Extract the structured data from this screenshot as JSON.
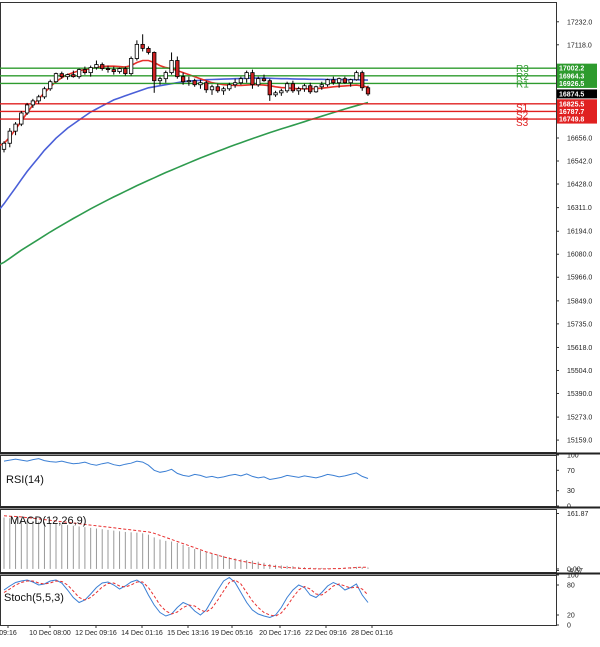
{
  "chart_data": {
    "type": "line",
    "instrument": "candlestick",
    "main": {
      "ylim": [
        15100,
        17330
      ],
      "yticks": [
        17232.0,
        17118.0,
        17002.2,
        16964.3,
        16926.5,
        16874.5,
        16825.5,
        16787.7,
        16749.8,
        16656.0,
        16542.0,
        16428.0,
        16311.0,
        16194.0,
        16080.0,
        15966.0,
        15849.0,
        15735.0,
        15618.0,
        15504.0,
        15390.0,
        15273.0,
        15159.0
      ],
      "tick_labels": [
        "17232.0",
        "17118.0",
        "17002.2",
        "16964.3",
        "16926.5",
        "16874.5",
        "16825.5",
        "16787.7",
        "16749.8",
        "16656.0",
        "16542.0",
        "16428.0",
        "16311.0",
        "16194.0",
        "16080.0",
        "15966.0",
        "15849.0",
        "15735.0",
        "15618.0",
        "15504.0",
        "15390.0",
        "15273.0",
        "15159.0"
      ],
      "current_price": {
        "value": 16874.5,
        "label": "16874.5",
        "color": "#000000"
      },
      "levels": [
        {
          "name": "R3",
          "value": 17002.2,
          "label": "17002.2",
          "color": "#2e9b2e"
        },
        {
          "name": "R2",
          "value": 16964.3,
          "label": "16964.3",
          "color": "#2e9b2e"
        },
        {
          "name": "R1",
          "value": 16926.5,
          "label": "16926.5",
          "color": "#2e9b2e"
        },
        {
          "name": "S1",
          "value": 16825.5,
          "label": "16825.5",
          "color": "#e02020"
        },
        {
          "name": "S2",
          "value": 16787.7,
          "label": "16787.7",
          "color": "#e02020"
        },
        {
          "name": "S3",
          "value": 16749.8,
          "label": "16749.8",
          "color": "#e02020"
        }
      ],
      "candles": [
        [
          16600,
          16640,
          16585,
          16630
        ],
        [
          16630,
          16705,
          16610,
          16690
        ],
        [
          16690,
          16735,
          16670,
          16725
        ],
        [
          16725,
          16790,
          16715,
          16780
        ],
        [
          16780,
          16830,
          16770,
          16820
        ],
        [
          16820,
          16850,
          16805,
          16840
        ],
        [
          16840,
          16870,
          16825,
          16860
        ],
        [
          16860,
          16910,
          16850,
          16900
        ],
        [
          16900,
          16945,
          16890,
          16935
        ],
        [
          16935,
          16980,
          16930,
          16975
        ],
        [
          16975,
          16985,
          16950,
          16960
        ],
        [
          16960,
          16975,
          16945,
          16970
        ],
        [
          16970,
          16990,
          16955,
          16960
        ],
        [
          16960,
          17000,
          16950,
          16995
        ],
        [
          16995,
          17010,
          16970,
          16980
        ],
        [
          16980,
          17015,
          16960,
          17005
        ],
        [
          17005,
          17040,
          16995,
          17020
        ],
        [
          17020,
          17030,
          16990,
          17000
        ],
        [
          17000,
          17015,
          16980,
          16995
        ],
        [
          16995,
          17010,
          16970,
          16985
        ],
        [
          16985,
          17005,
          16975,
          17000
        ],
        [
          17000,
          17010,
          16965,
          16975
        ],
        [
          16975,
          17060,
          16965,
          17050
        ],
        [
          17050,
          17140,
          17040,
          17120
        ],
        [
          17120,
          17170,
          17085,
          17100
        ],
        [
          17100,
          17110,
          17070,
          17080
        ],
        [
          17080,
          17085,
          16880,
          16940
        ],
        [
          16940,
          16960,
          16920,
          16950
        ],
        [
          16950,
          16990,
          16930,
          16980
        ],
        [
          16980,
          17080,
          16970,
          17040
        ],
        [
          17040,
          17060,
          16950,
          16960
        ],
        [
          16960,
          16980,
          16920,
          16935
        ],
        [
          16935,
          16960,
          16915,
          16940
        ],
        [
          16940,
          16950,
          16910,
          16920
        ],
        [
          16920,
          16945,
          16900,
          16930
        ],
        [
          16930,
          16940,
          16880,
          16895
        ],
        [
          16895,
          16920,
          16870,
          16910
        ],
        [
          16910,
          16925,
          16880,
          16890
        ],
        [
          16890,
          16910,
          16870,
          16900
        ],
        [
          16900,
          16930,
          16890,
          16920
        ],
        [
          16920,
          16950,
          16905,
          16930
        ],
        [
          16930,
          16960,
          16920,
          16950
        ],
        [
          16950,
          16990,
          16930,
          16980
        ],
        [
          16980,
          16995,
          16900,
          16920
        ],
        [
          16920,
          16960,
          16910,
          16950
        ],
        [
          16950,
          16970,
          16935,
          16940
        ],
        [
          16940,
          16950,
          16840,
          16870
        ],
        [
          16870,
          16890,
          16860,
          16880
        ],
        [
          16880,
          16900,
          16865,
          16890
        ],
        [
          16890,
          16935,
          16880,
          16925
        ],
        [
          16925,
          16940,
          16880,
          16890
        ],
        [
          16890,
          16910,
          16870,
          16900
        ],
        [
          16900,
          16925,
          16885,
          16915
        ],
        [
          16915,
          16930,
          16875,
          16885
        ],
        [
          16885,
          16915,
          16880,
          16910
        ],
        [
          16910,
          16935,
          16895,
          16920
        ],
        [
          16920,
          16950,
          16910,
          16945
        ],
        [
          16945,
          16960,
          16920,
          16930
        ],
        [
          16930,
          16955,
          16905,
          16950
        ],
        [
          16950,
          16960,
          16925,
          16930
        ],
        [
          16930,
          16950,
          16910,
          16945
        ],
        [
          16945,
          16990,
          16940,
          16980
        ],
        [
          16980,
          16990,
          16890,
          16905
        ],
        [
          16905,
          16915,
          16865,
          16874.5
        ]
      ],
      "ma_red": [
        16630,
        16660,
        16700,
        16740,
        16780,
        16820,
        16850,
        16880,
        16910,
        16935,
        16955,
        16970,
        16980,
        16990,
        16995,
        17000,
        17005,
        17010,
        17012,
        17012,
        17010,
        17008,
        17015,
        17030,
        17040,
        17040,
        17030,
        17015,
        17005,
        17000,
        16990,
        16980,
        16970,
        16960,
        16950,
        16940,
        16930,
        16925,
        16920,
        16918,
        16916,
        16916,
        16918,
        16920,
        16920,
        16918,
        16915,
        16910,
        16906,
        16905,
        16902,
        16900,
        16900,
        16900,
        16901,
        16903,
        16906,
        16910,
        16912,
        16914,
        16916,
        16918,
        16914,
        16908
      ],
      "ma_blue": [
        16330,
        16370,
        16410,
        16450,
        16490,
        16525,
        16560,
        16595,
        16625,
        16655,
        16680,
        16705,
        16725,
        16745,
        16765,
        16785,
        16800,
        16815,
        16830,
        16845,
        16855,
        16865,
        16875,
        16885,
        16895,
        16905,
        16910,
        16915,
        16920,
        16925,
        16930,
        16935,
        16938,
        16940,
        16942,
        16945,
        16946,
        16947,
        16948,
        16949,
        16950,
        16951,
        16952,
        16953,
        16953,
        16953,
        16952,
        16951,
        16950,
        16950,
        16949,
        16948,
        16948,
        16947,
        16947,
        16947,
        16946,
        16946,
        16946,
        16945,
        16945,
        16945,
        16944,
        16943
      ],
      "ma_green": [
        16040,
        16060,
        16080,
        16100,
        16118,
        16136,
        16154,
        16172,
        16190,
        16207,
        16224,
        16241,
        16257,
        16273,
        16289,
        16305,
        16320,
        16335,
        16350,
        16364,
        16378,
        16392,
        16406,
        16420,
        16433,
        16446,
        16459,
        16472,
        16485,
        16497,
        16509,
        16521,
        16533,
        16545,
        16557,
        16568,
        16579,
        16590,
        16601,
        16612,
        16623,
        16633,
        16643,
        16653,
        16663,
        16673,
        16683,
        16692,
        16701,
        16710,
        16719,
        16728,
        16737,
        16746,
        16755,
        16764,
        16773,
        16782,
        16791,
        16800,
        16808,
        16816,
        16824,
        16832
      ]
    },
    "rsi": {
      "label": "RSI(14)",
      "ylim": [
        0,
        100
      ],
      "yticks": [
        100,
        70,
        30,
        0
      ],
      "tick_labels": [
        "100",
        "70",
        "30",
        "0"
      ],
      "values": [
        88,
        90,
        92,
        90,
        88,
        91,
        93,
        89,
        87,
        86,
        88,
        85,
        83,
        84,
        86,
        82,
        80,
        83,
        85,
        81,
        79,
        82,
        84,
        88,
        86,
        80,
        70,
        66,
        68,
        72,
        64,
        60,
        58,
        62,
        60,
        56,
        58,
        55,
        57,
        60,
        62,
        59,
        63,
        58,
        55,
        57,
        52,
        54,
        56,
        60,
        58,
        56,
        59,
        57,
        55,
        58,
        62,
        60,
        57,
        59,
        62,
        65,
        58,
        54
      ]
    },
    "macd": {
      "label": "MACD(12,26,9)",
      "ylim": [
        -9,
        175
      ],
      "yticks": [
        161.87,
        0.0,
        -4.57
      ],
      "tick_labels": [
        "161.87",
        "0.00",
        "-4.57"
      ],
      "histogram": [
        150,
        148,
        146,
        144,
        142,
        140,
        138,
        136,
        134,
        132,
        130,
        128,
        126,
        124,
        122,
        120,
        118,
        116,
        114,
        112,
        110,
        108,
        107,
        106,
        104,
        100,
        92,
        86,
        82,
        80,
        76,
        70,
        64,
        58,
        54,
        50,
        46,
        42,
        38,
        34,
        31,
        28,
        26,
        24,
        21,
        18,
        14,
        12,
        10,
        9,
        8,
        6,
        5,
        4,
        3,
        3,
        2,
        2,
        3,
        4,
        5,
        6,
        5,
        4
      ],
      "signal": [
        155,
        154,
        153,
        152,
        150,
        148,
        146,
        144,
        142,
        140,
        138,
        136,
        134,
        132,
        130,
        128,
        126,
        124,
        122,
        120,
        118,
        116,
        114,
        112,
        110,
        108,
        104,
        98,
        92,
        86,
        80,
        74,
        68,
        62,
        56,
        50,
        45,
        40,
        35,
        31,
        27,
        23,
        20,
        17,
        14,
        11,
        9,
        7,
        5,
        4,
        3,
        2,
        1,
        1,
        0,
        0,
        0,
        1,
        1,
        2,
        3,
        4,
        5,
        5
      ]
    },
    "stoch": {
      "label": "Stoch(5,5,3)",
      "ylim": [
        0,
        100
      ],
      "yticks": [
        100,
        80,
        20,
        0
      ],
      "tick_labels": [
        "100",
        "80",
        "20",
        "0"
      ],
      "k": [
        70,
        78,
        85,
        88,
        90,
        86,
        80,
        82,
        88,
        90,
        84,
        70,
        55,
        45,
        50,
        62,
        75,
        84,
        86,
        80,
        72,
        78,
        86,
        90,
        82,
        60,
        40,
        25,
        18,
        22,
        35,
        45,
        40,
        28,
        20,
        30,
        50,
        70,
        88,
        95,
        85,
        65,
        45,
        30,
        22,
        18,
        15,
        20,
        35,
        55,
        70,
        80,
        75,
        60,
        55,
        65,
        78,
        85,
        80,
        70,
        75,
        82,
        60,
        45
      ],
      "d": [
        65,
        72,
        80,
        85,
        88,
        88,
        84,
        82,
        84,
        88,
        87,
        80,
        68,
        55,
        50,
        55,
        65,
        76,
        83,
        84,
        78,
        76,
        80,
        86,
        86,
        75,
        58,
        40,
        28,
        22,
        26,
        35,
        40,
        38,
        30,
        26,
        34,
        50,
        68,
        85,
        90,
        82,
        65,
        48,
        35,
        25,
        20,
        18,
        24,
        38,
        55,
        70,
        77,
        72,
        62,
        60,
        68,
        78,
        82,
        78,
        74,
        76,
        72,
        60
      ]
    },
    "x_labels": [
      "09:16",
      "10 Dec 08:00",
      "12 Dec 09:16",
      "14 Dec 01:16",
      "15 Dec 13:16",
      "19 Dec 05:16",
      "20 Dec 17:16",
      "22 Dec 09:16",
      "28 Dec 01:16"
    ],
    "colors": {
      "up_candle": "#ffffff",
      "down_candle": "#cc2222",
      "candle_outline": "#000000",
      "ma_red": "#e8312a",
      "ma_blue": "#4a5fd8",
      "ma_green": "#2e9b4e",
      "indicator_line": "#3b7fd4",
      "stoch_signal": "#e83030",
      "macd_hist": "#999999",
      "macd_signal": "#e83030"
    }
  }
}
